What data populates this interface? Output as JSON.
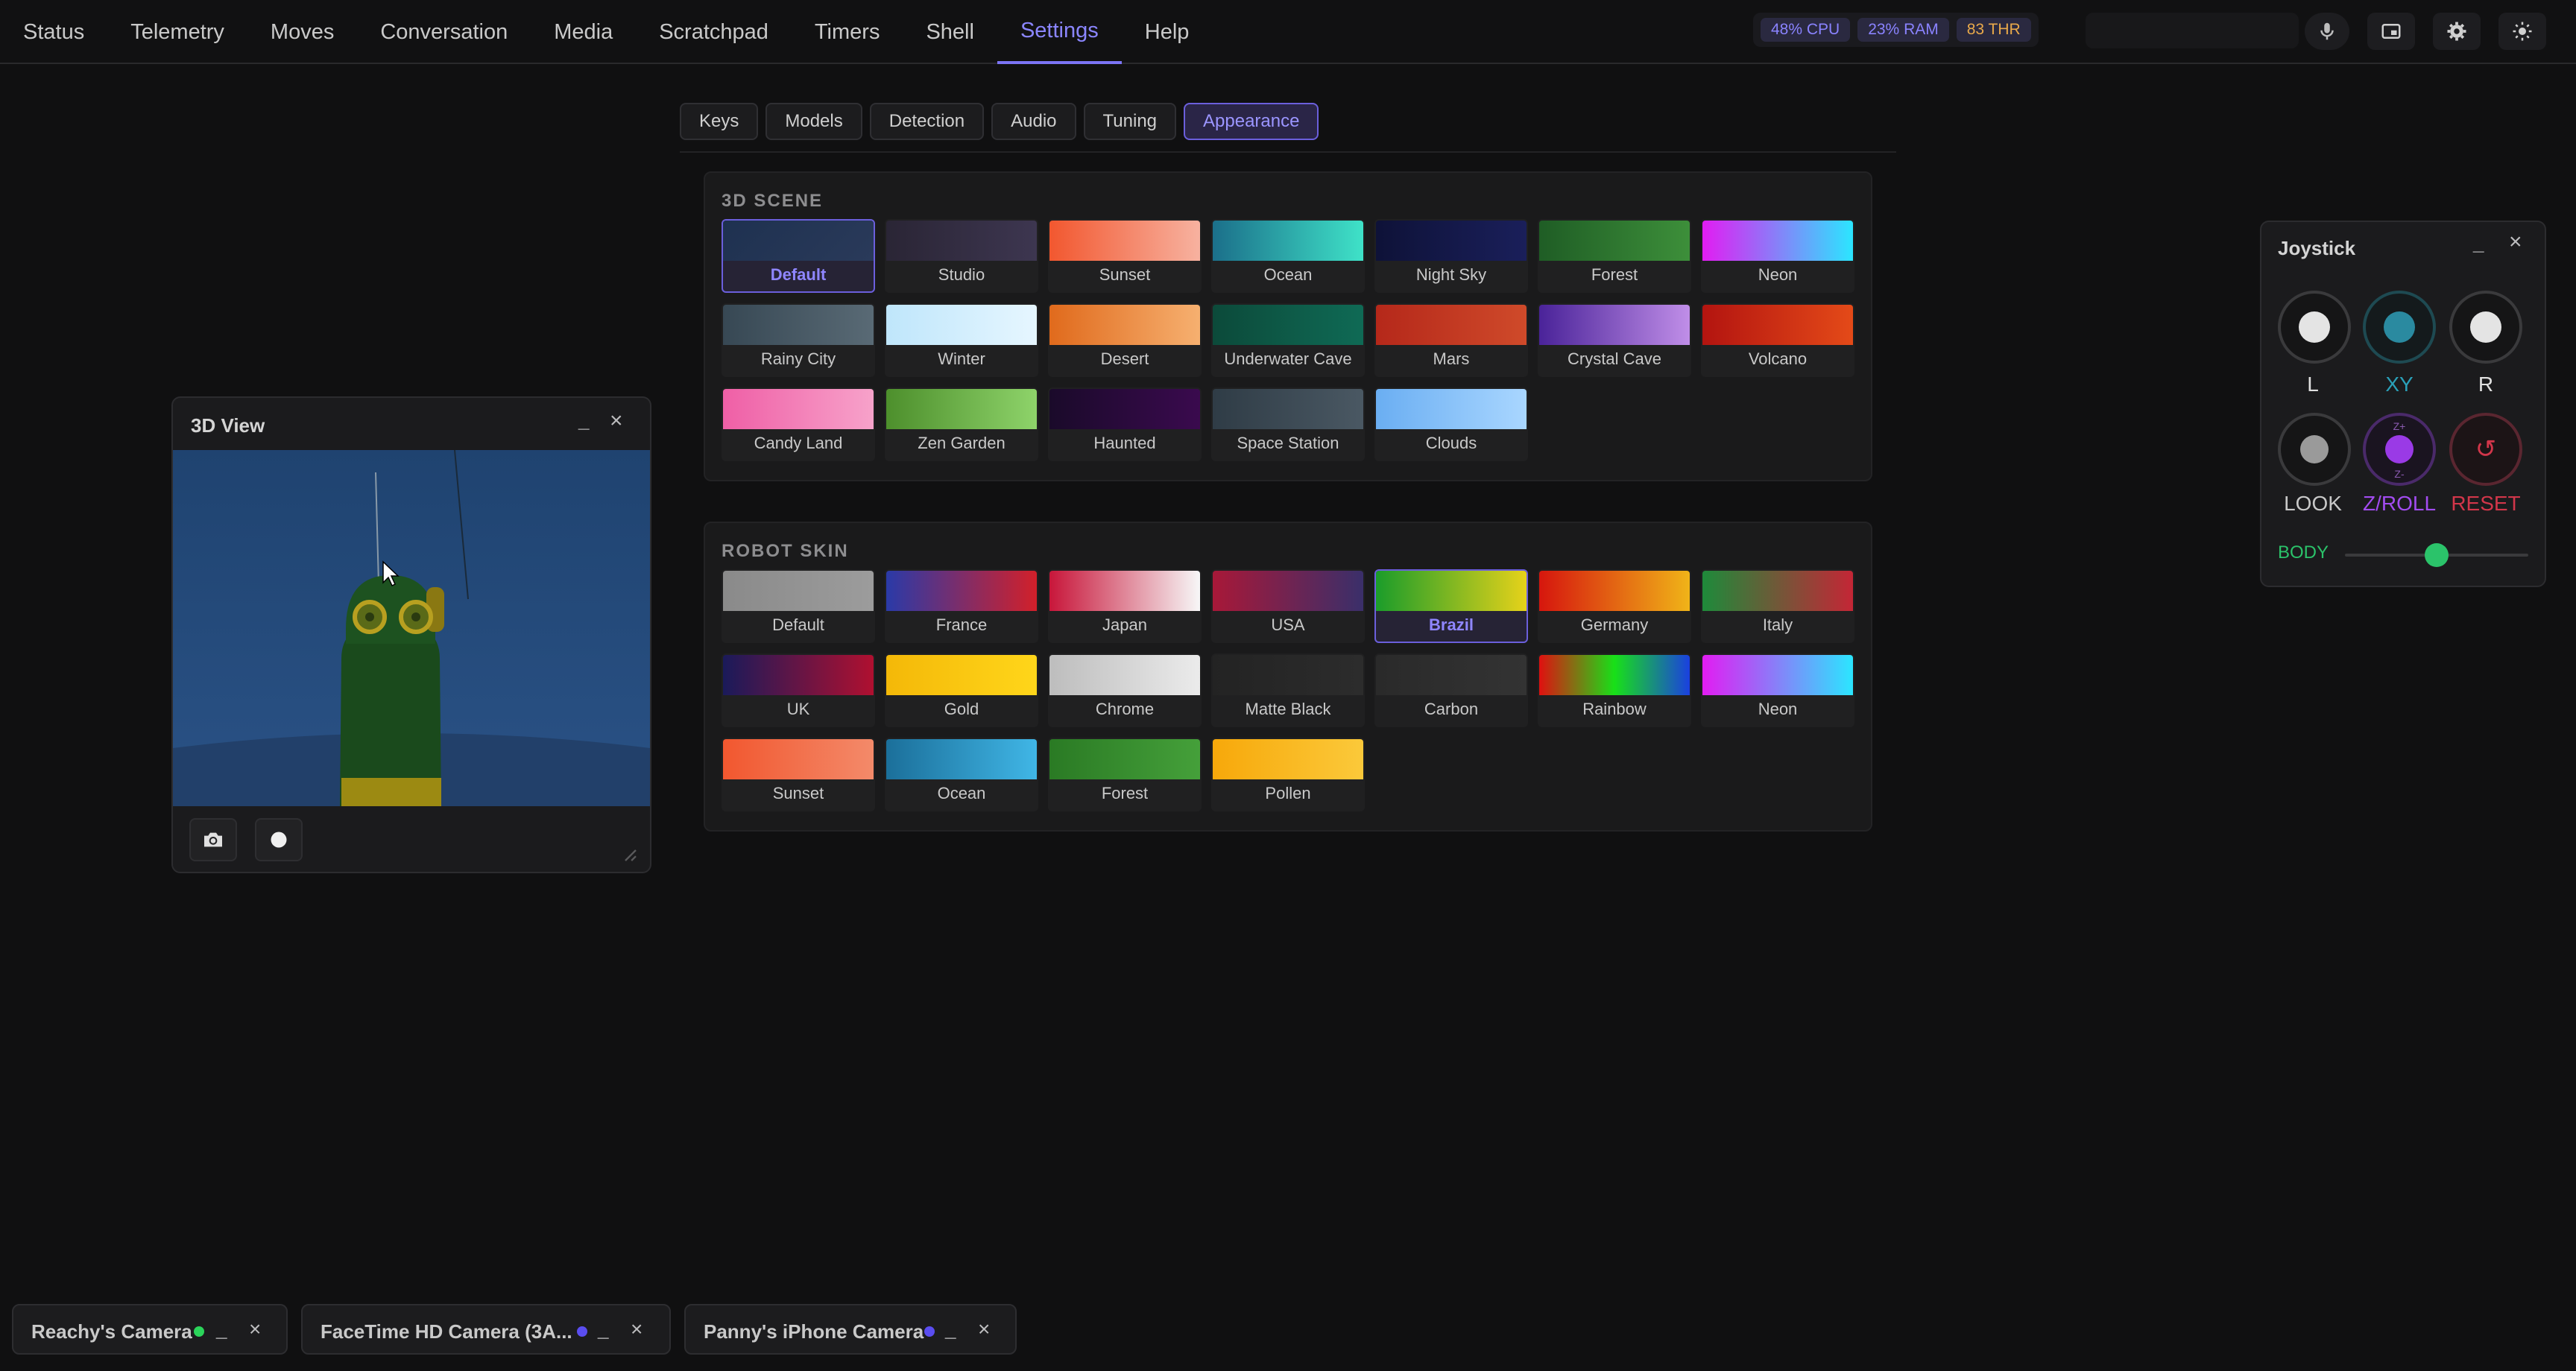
{
  "nav": {
    "tabs": [
      "Status",
      "Telemetry",
      "Moves",
      "Conversation",
      "Media",
      "Scratchpad",
      "Timers",
      "Shell",
      "Settings",
      "Help"
    ],
    "active": "Settings"
  },
  "stats": {
    "cpu": "48% CPU",
    "ram": "23% RAM",
    "thr": "83 THR"
  },
  "top_icons": [
    "microphone-icon",
    "picture-in-picture-icon",
    "gear-icon",
    "sun-icon"
  ],
  "settings": {
    "subtabs": [
      "Keys",
      "Models",
      "Detection",
      "Audio",
      "Tuning",
      "Appearance"
    ],
    "active": "Appearance"
  },
  "scene": {
    "title": "3D SCENE",
    "selected": "Default",
    "options": [
      {
        "label": "Default",
        "color": "linear-gradient(135deg,#1e3150,#2a3a5a)"
      },
      {
        "label": "Studio",
        "color": "linear-gradient(90deg,#2a2535,#3d3650)"
      },
      {
        "label": "Sunset",
        "color": "linear-gradient(90deg,#f2572f,#f7b2a0)"
      },
      {
        "label": "Ocean",
        "color": "linear-gradient(90deg,#1b6f8a,#3fe2c8)"
      },
      {
        "label": "Night Sky",
        "color": "linear-gradient(90deg,#0e1238,#1a1f5a)"
      },
      {
        "label": "Forest",
        "color": "linear-gradient(90deg,#1f5d25,#3d8f3a)"
      },
      {
        "label": "Neon",
        "color": "linear-gradient(90deg,#e21cf2,#2be6ff)"
      },
      {
        "label": "Rainy City",
        "color": "linear-gradient(90deg,#374854,#596a75)"
      },
      {
        "label": "Winter",
        "color": "linear-gradient(90deg,#bfe6fb,#e6f6ff)"
      },
      {
        "label": "Desert",
        "color": "linear-gradient(90deg,#e06a1c,#f6b070)"
      },
      {
        "label": "Underwater Cave",
        "color": "linear-gradient(90deg,#0c4a3a,#0f6a55)"
      },
      {
        "label": "Mars",
        "color": "linear-gradient(90deg,#b5281a,#cf4a2a)"
      },
      {
        "label": "Crystal Cave",
        "color": "linear-gradient(90deg,#4a2399,#c08ee8)"
      },
      {
        "label": "Volcano",
        "color": "linear-gradient(90deg,#b31410,#e44a18)"
      },
      {
        "label": "Candy Land",
        "color": "linear-gradient(90deg,#ef5fa6,#f7a2ca)"
      },
      {
        "label": "Zen Garden",
        "color": "linear-gradient(90deg,#4d8f2c,#8ed36a)"
      },
      {
        "label": "Haunted",
        "color": "linear-gradient(90deg,#1a0a2a,#3a0a4e)"
      },
      {
        "label": "Space Station",
        "color": "linear-gradient(90deg,#2f3c46,#4a5863)"
      },
      {
        "label": "Clouds",
        "color": "linear-gradient(90deg,#6aaef2,#a9d6ff)"
      }
    ]
  },
  "skin": {
    "title": "ROBOT SKIN",
    "selected": "Brazil",
    "options": [
      {
        "label": "Default",
        "color": "linear-gradient(90deg,#8a8a8a,#9c9c9c)"
      },
      {
        "label": "France",
        "color": "linear-gradient(90deg,#2a3aa8,#d2202a)"
      },
      {
        "label": "Japan",
        "color": "linear-gradient(90deg,#c8163a,#f7f7f7)"
      },
      {
        "label": "USA",
        "color": "linear-gradient(90deg,#a81838,#3a2f6a)"
      },
      {
        "label": "Brazil",
        "color": "linear-gradient(90deg,#1a9c2a,#e6d21a)"
      },
      {
        "label": "Germany",
        "color": "linear-gradient(90deg,#d6160e,#f0b418)"
      },
      {
        "label": "Italy",
        "color": "linear-gradient(90deg,#1e8a3a,#c42636)"
      },
      {
        "label": "UK",
        "color": "linear-gradient(90deg,#1a1a5a,#b01030)"
      },
      {
        "label": "Gold",
        "color": "linear-gradient(90deg,#f4b808,#ffd61a)"
      },
      {
        "label": "Chrome",
        "color": "linear-gradient(90deg,#bdbdbd,#ebebeb)"
      },
      {
        "label": "Matte Black",
        "color": "linear-gradient(90deg,#232323,#2c2c2c)"
      },
      {
        "label": "Carbon",
        "color": "linear-gradient(90deg,#2a2a2a,#333333)"
      },
      {
        "label": "Rainbow",
        "color": "linear-gradient(90deg,#e01010,#18e018,#1a40e0)"
      },
      {
        "label": "Neon",
        "color": "linear-gradient(90deg,#e21cf2,#2be6ff)"
      },
      {
        "label": "Sunset",
        "color": "linear-gradient(90deg,#f2572f,#f38a6a)"
      },
      {
        "label": "Ocean",
        "color": "linear-gradient(90deg,#1b6f9a,#40b6e6)"
      },
      {
        "label": "Forest",
        "color": "linear-gradient(90deg,#2a7a24,#45a03a)"
      },
      {
        "label": "Pollen",
        "color": "linear-gradient(90deg,#f7a80a,#fbc93a)"
      }
    ]
  },
  "view3d": {
    "title": "3D View",
    "min": "_",
    "close": "×"
  },
  "joystick": {
    "title": "Joystick",
    "min": "_",
    "close": "×",
    "row1": [
      "L",
      "XY",
      "R"
    ],
    "row2": [
      "LOOK",
      "Z/ROLL",
      "RESET"
    ],
    "zplus": "Z+",
    "zminus": "Z-",
    "body_label": "BODY",
    "body_value": 0.5,
    "colors": {
      "xy": "#2aa0b8",
      "zroll": "#a24cf0",
      "reset": "#d2364a",
      "body": "#2bc36a"
    }
  },
  "cameras": [
    {
      "name": "Reachy's Camera",
      "dot": "#2bd45a"
    },
    {
      "name": "FaceTime HD Camera (3A...",
      "dot": "#5a4df0"
    },
    {
      "name": "Panny's iPhone Camera",
      "dot": "#5a4df0"
    }
  ],
  "window_controls": {
    "min": "_",
    "close": "×"
  }
}
